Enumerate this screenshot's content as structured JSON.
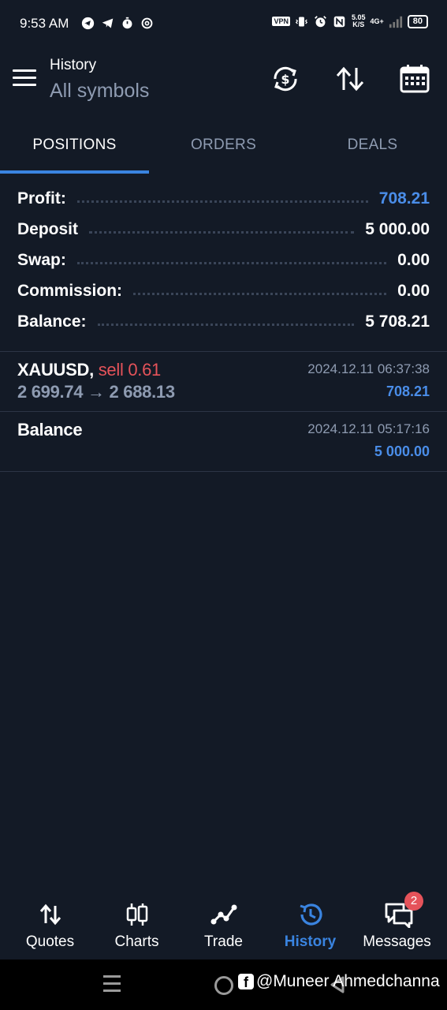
{
  "status_bar": {
    "time": "9:53 AM",
    "vpn": "VPN",
    "net_speed_value": "5.05",
    "net_speed_unit": "K/S",
    "net_type": "4G+",
    "battery": "80",
    "icons": [
      "telegram-icon",
      "telegram-icon",
      "timer-icon",
      "threads-icon",
      "vibrate-icon",
      "alarm-icon",
      "nfc-icon",
      "signal-icon"
    ]
  },
  "toolbar": {
    "title": "History",
    "subtitle": "All symbols",
    "icons": [
      "sync-currency-icon",
      "sort-icon",
      "calendar-icon"
    ]
  },
  "tabs": [
    {
      "label": "POSITIONS",
      "active": true
    },
    {
      "label": "ORDERS",
      "active": false
    },
    {
      "label": "DEALS",
      "active": false
    }
  ],
  "summary": [
    {
      "label": "Profit:",
      "value": "708.21",
      "highlight": true
    },
    {
      "label": "Deposit",
      "value": "5 000.00",
      "highlight": false
    },
    {
      "label": "Swap:",
      "value": "0.00",
      "highlight": false
    },
    {
      "label": "Commission:",
      "value": "0.00",
      "highlight": false
    },
    {
      "label": "Balance:",
      "value": "5 708.21",
      "highlight": false
    }
  ],
  "positions": [
    {
      "symbol": "XAUUSD,",
      "direction": "sell 0.61",
      "prices": "2 699.74 → 2 688.13",
      "date": "2024.12.11 06:37:38",
      "profit": "708.21"
    },
    {
      "symbol": "Balance",
      "direction": "",
      "prices": "",
      "date": "2024.12.11 05:17:16",
      "profit": "5 000.00"
    }
  ],
  "bottom_nav": [
    {
      "label": "Quotes",
      "icon": "quotes-icon",
      "active": false
    },
    {
      "label": "Charts",
      "icon": "candlestick-icon",
      "active": false
    },
    {
      "label": "Trade",
      "icon": "trade-line-icon",
      "active": false
    },
    {
      "label": "History",
      "icon": "history-icon",
      "active": true
    },
    {
      "label": "Messages",
      "icon": "messages-icon",
      "active": false,
      "badge": "2"
    }
  ],
  "watermark": {
    "text": "@Muneer Ahmedchanna"
  },
  "colors": {
    "background": "#131a26",
    "accent_blue": "#3a84e0",
    "profit_blue": "#4a8de8",
    "sell_red": "#e5535a",
    "muted": "#8e9bb1"
  }
}
